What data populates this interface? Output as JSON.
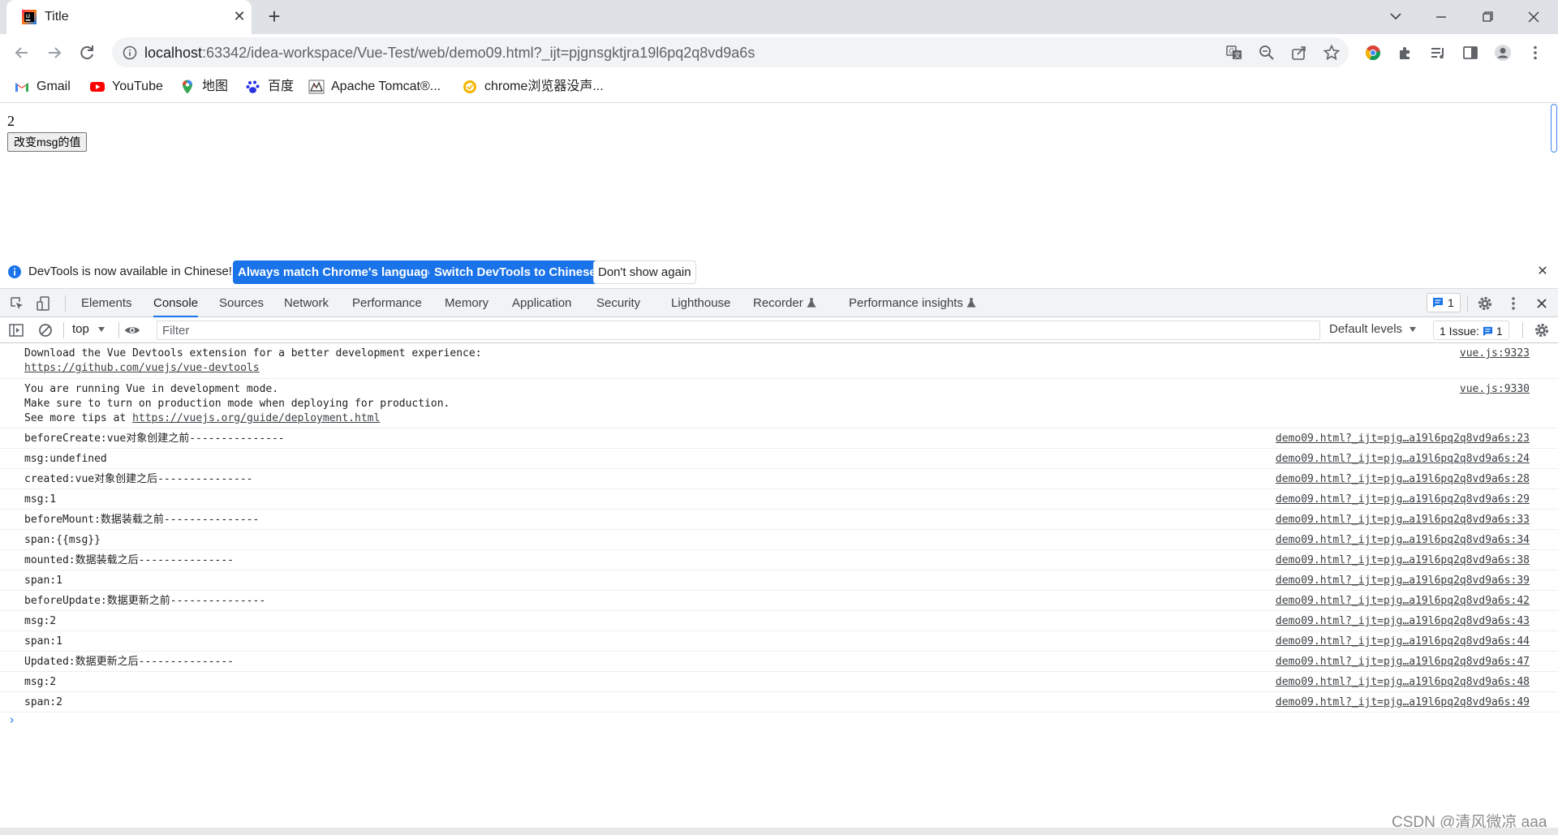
{
  "tab": {
    "title": "Title",
    "close": "✕",
    "new_tab": "+"
  },
  "omnibox": {
    "host": "localhost",
    "rest": ":63342/idea-workspace/Vue-Test/web/demo09.html?_ijt=pjgnsgktjra19l6pq2q8vd9a6s"
  },
  "bookmarks": [
    {
      "label": "Gmail",
      "icon": "gmail-icon"
    },
    {
      "label": "YouTube",
      "icon": "youtube-icon"
    },
    {
      "label": "地图",
      "icon": "maps-pin-icon"
    },
    {
      "label": "百度",
      "icon": "baidu-paw-icon"
    },
    {
      "label": "Apache Tomcat®...",
      "icon": "tomcat-icon"
    },
    {
      "label": "chrome浏览器没声...",
      "icon": "chrome-tip-icon"
    }
  ],
  "page": {
    "msg_value": "2",
    "button_label": "改变msg的值"
  },
  "infobar": {
    "text": "DevTools is now available in Chinese!",
    "btn_match": "Always match Chrome's language",
    "btn_switch": "Switch DevTools to Chinese",
    "btn_dismiss": "Don't show again",
    "close": "✕"
  },
  "devtools": {
    "tabs": [
      "Elements",
      "Console",
      "Sources",
      "Network",
      "Performance",
      "Memory",
      "Application",
      "Security",
      "Lighthouse",
      "Recorder",
      "Performance insights"
    ],
    "active_tab": "Console",
    "issues_badge": "1"
  },
  "console_bar": {
    "context": "top",
    "filter_placeholder": "Filter",
    "levels": "Default levels",
    "issues_label": "1 Issue:",
    "issues_count": "1"
  },
  "messages": [
    {
      "lines": [
        "Download the Vue Devtools extension for a better development experience:"
      ],
      "link": "https://github.com/vuejs/vue-devtools",
      "link_prefix": "",
      "source": "vue.js:9323"
    },
    {
      "lines": [
        "You are running Vue in development mode.",
        "Make sure to turn on production mode when deploying for production."
      ],
      "link_prefix": "See more tips at ",
      "link": "https://vuejs.org/guide/deployment.html",
      "source": "vue.js:9330"
    },
    {
      "lines": [
        "beforeCreate:vue对象创建之前---------------"
      ],
      "source": "demo09.html?_ijt=pjg…a19l6pq2q8vd9a6s:23"
    },
    {
      "lines": [
        "msg:undefined"
      ],
      "source": "demo09.html?_ijt=pjg…a19l6pq2q8vd9a6s:24"
    },
    {
      "lines": [
        "created:vue对象创建之后---------------"
      ],
      "source": "demo09.html?_ijt=pjg…a19l6pq2q8vd9a6s:28"
    },
    {
      "lines": [
        "msg:1"
      ],
      "source": "demo09.html?_ijt=pjg…a19l6pq2q8vd9a6s:29"
    },
    {
      "lines": [
        "beforeMount:数据装载之前---------------"
      ],
      "source": "demo09.html?_ijt=pjg…a19l6pq2q8vd9a6s:33"
    },
    {
      "lines": [
        "span:{{msg}}"
      ],
      "source": "demo09.html?_ijt=pjg…a19l6pq2q8vd9a6s:34"
    },
    {
      "lines": [
        "mounted:数据装载之后---------------"
      ],
      "source": "demo09.html?_ijt=pjg…a19l6pq2q8vd9a6s:38"
    },
    {
      "lines": [
        "span:1"
      ],
      "source": "demo09.html?_ijt=pjg…a19l6pq2q8vd9a6s:39"
    },
    {
      "lines": [
        "beforeUpdate:数据更新之前---------------"
      ],
      "source": "demo09.html?_ijt=pjg…a19l6pq2q8vd9a6s:42"
    },
    {
      "lines": [
        "msg:2"
      ],
      "source": "demo09.html?_ijt=pjg…a19l6pq2q8vd9a6s:43"
    },
    {
      "lines": [
        "span:1"
      ],
      "source": "demo09.html?_ijt=pjg…a19l6pq2q8vd9a6s:44"
    },
    {
      "lines": [
        "Updated:数据更新之后---------------"
      ],
      "source": "demo09.html?_ijt=pjg…a19l6pq2q8vd9a6s:47"
    },
    {
      "lines": [
        "msg:2"
      ],
      "source": "demo09.html?_ijt=pjg…a19l6pq2q8vd9a6s:48"
    },
    {
      "lines": [
        "span:2"
      ],
      "source": "demo09.html?_ijt=pjg…a19l6pq2q8vd9a6s:49"
    }
  ],
  "prompt": "›",
  "watermark": "CSDN @清风微凉 aaa",
  "colors": {
    "accent": "#1a73e8",
    "tabstrip": "#dee1e6",
    "omnibox": "#f1f3f4"
  }
}
